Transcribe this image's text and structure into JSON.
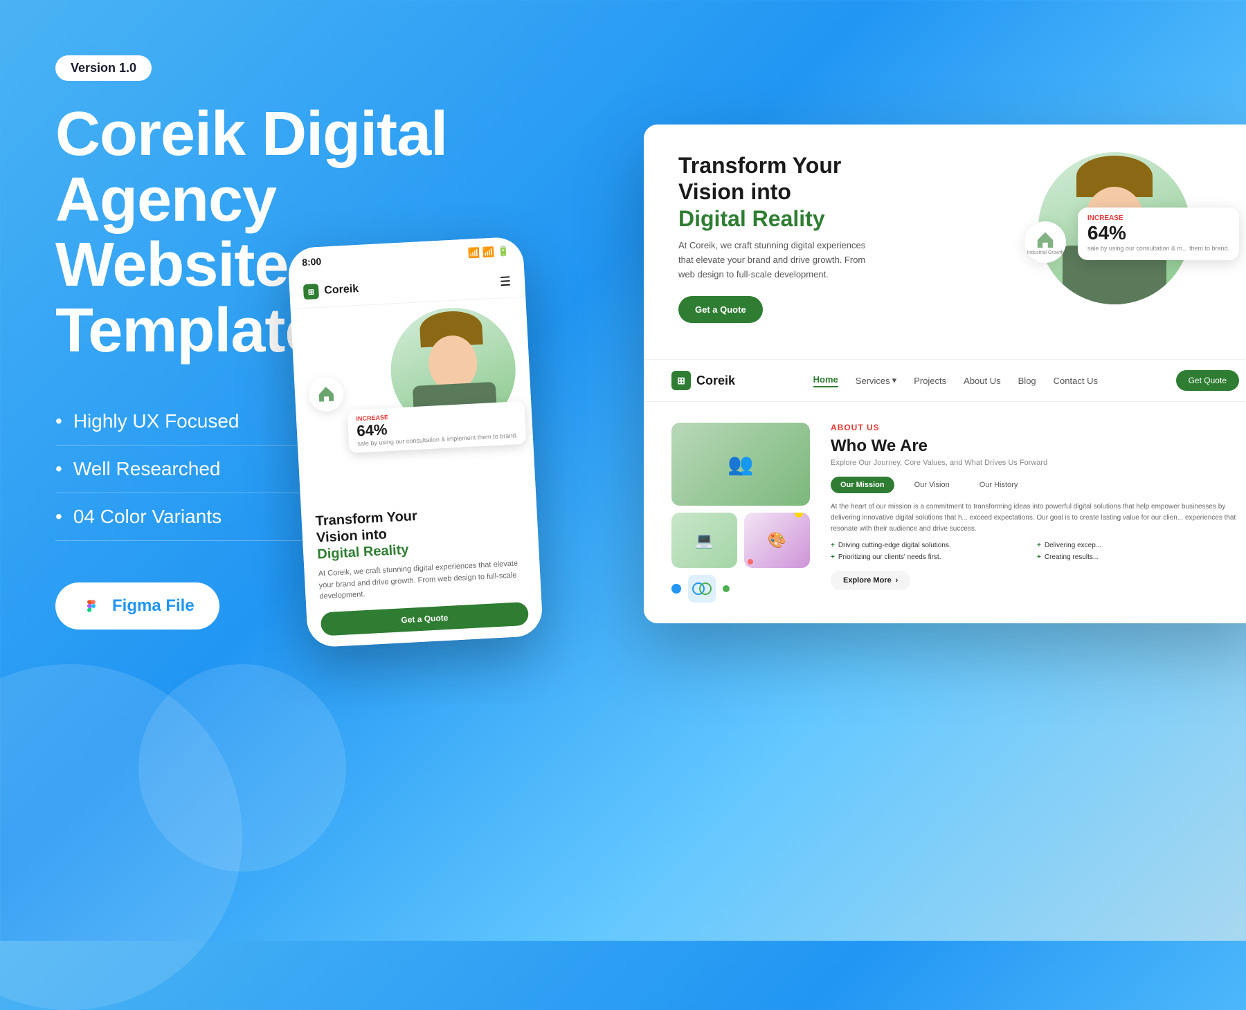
{
  "background": {
    "gradient_start": "#4ab3f4",
    "gradient_end": "#64c8ff"
  },
  "version_badge": {
    "label": "Version 1.0"
  },
  "main_title": {
    "line1": "Coreik Digital",
    "line2": "Agency Website",
    "line3": "Template"
  },
  "features": [
    {
      "text": "Highly UX Focused"
    },
    {
      "text": "Well Researched"
    },
    {
      "text": "04 Color Variants"
    }
  ],
  "figma_button": {
    "label": "Figma File"
  },
  "phone": {
    "status_time": "8:00",
    "logo_name": "Coreik",
    "hero_title_line1": "Transform Your",
    "hero_title_line2": "Vision into",
    "hero_title_line3": "Digital Reality",
    "hero_description": "At Coreik, we craft stunning digital experiences that elevate your brand and drive growth. From web design to full-scale development.",
    "cta_label": "Get a Quote",
    "stat_label": "INCREASE",
    "stat_percent": "64%",
    "stat_text": "sale by using our consultation & implement them to brand.",
    "house_badge_label": "Industrial Growth"
  },
  "desktop": {
    "nav": {
      "logo": "Coreik",
      "links": [
        {
          "label": "Home",
          "active": true
        },
        {
          "label": "Services",
          "active": false
        },
        {
          "label": "Projects",
          "active": false
        },
        {
          "label": "About Us",
          "active": false
        },
        {
          "label": "Blog",
          "active": false
        },
        {
          "label": "Contact Us",
          "active": false
        }
      ],
      "cta_label": "Get Quote"
    },
    "hero": {
      "title_line1": "Transform Your",
      "title_line2": "Vision into",
      "title_green": "Digital Reality",
      "description": "At Coreik, we craft stunning digital experiences that elevate your brand and drive growth. From web design to full-scale development.",
      "cta_label": "Get a Quote",
      "stat_increase": "INCREASE",
      "stat_percent": "64%",
      "stat_text": "sale by using our consultation & m... them to brand.",
      "house_label": "Industrial Growth"
    },
    "about": {
      "label": "ABOUT US",
      "title": "Who We Are",
      "subtitle": "Explore Our Journey, Core Values, and What Drives Us Forward",
      "tabs": [
        {
          "label": "Our Mission",
          "active": true
        },
        {
          "label": "Our Vision",
          "active": false
        },
        {
          "label": "Our History",
          "active": false
        }
      ],
      "description": "At the heart of our mission is a commitment to transforming ideas into powerful digital solutions that help empower businesses by delivering innovative digital solutions that h... exceed expectations. Our goal is to create lasting value for our clien... experiences that resonate with their audience and drive success.",
      "bullets": [
        "Driving cutting-edge digital solutions.",
        "Delivering excep...",
        "Prioritizing our clients' needs first.",
        "Creating results..."
      ],
      "explore_btn": "Explore More"
    }
  }
}
